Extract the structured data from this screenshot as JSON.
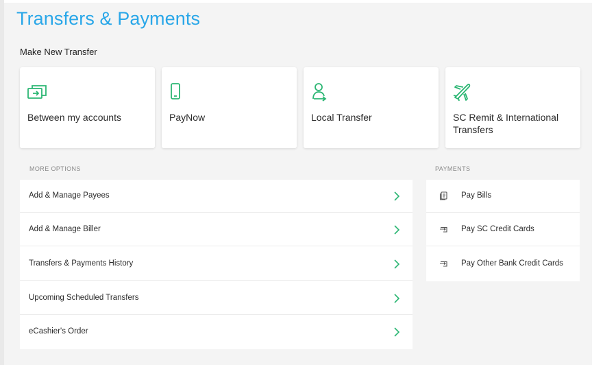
{
  "header": {
    "title": "Transfers & Payments"
  },
  "new_transfer": {
    "section_label": "Make New Transfer",
    "cards": [
      {
        "label": "Between my accounts",
        "icon": "transfer-accounts-icon"
      },
      {
        "label": "PayNow",
        "icon": "mobile-phone-icon"
      },
      {
        "label": "Local Transfer",
        "icon": "person-transfer-icon"
      },
      {
        "label": "SC Remit & International Transfers",
        "icon": "airplane-icon"
      }
    ]
  },
  "more_options": {
    "heading": "MORE OPTIONS",
    "items": [
      {
        "label": "Add & Manage Payees"
      },
      {
        "label": "Add & Manage Biller"
      },
      {
        "label": "Transfers & Payments History"
      },
      {
        "label": "Upcoming Scheduled Transfers"
      },
      {
        "label": "eCashier's Order"
      }
    ]
  },
  "payments": {
    "heading": "PAYMENTS",
    "items": [
      {
        "label": "Pay Bills",
        "icon": "bill-document-icon"
      },
      {
        "label": "Pay SC Credit Cards",
        "icon": "credit-card-icon"
      },
      {
        "label": "Pay Other Bank Credit Cards",
        "icon": "credit-card-icon"
      }
    ]
  },
  "colors": {
    "title": "#2aa7e8",
    "accent_green": "#2bb673"
  }
}
